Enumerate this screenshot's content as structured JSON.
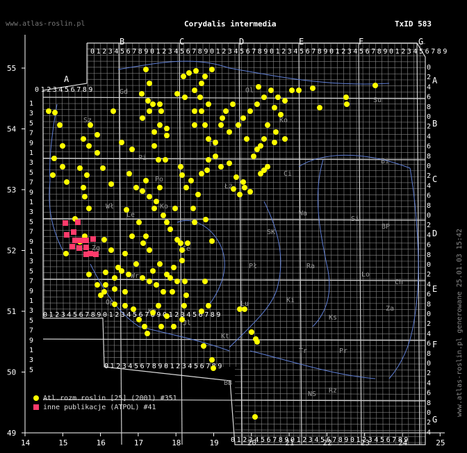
{
  "header": {
    "site": "www.atlas-roslin.pl",
    "title": "Corydalis intermedia",
    "taxid": "TxID 583"
  },
  "side_note": "www.atlas-roslin.pl generowane 25.01.03 15:42",
  "axes": {
    "x_ticks": [
      "14",
      "15",
      "16",
      "17",
      "18",
      "19",
      "20",
      "21",
      "22",
      "23",
      "24",
      "25"
    ],
    "y_ticks": [
      "49",
      "50",
      "51",
      "52",
      "53",
      "54",
      "55"
    ]
  },
  "grid_labels": {
    "columns": [
      "A",
      "B",
      "C",
      "D",
      "E",
      "F",
      "G"
    ],
    "rows": [
      "A",
      "B",
      "C",
      "D",
      "E",
      "F",
      "G"
    ],
    "digits": "0123456789"
  },
  "region_codes": [
    "Gd",
    "Su",
    "Ko",
    "Ol",
    "Bi",
    "Sz",
    "Pi",
    "To",
    "Ci",
    "Wa",
    "Si",
    "Łż",
    "Lo",
    "BP",
    "Po",
    "Ko",
    "SK",
    "Pł",
    "Ra",
    "Lu",
    "Ch",
    "Wr",
    "Op",
    "Kt",
    "Ki",
    "Tr",
    "Za",
    "Rz",
    "Ks",
    "NS",
    "BB",
    "Pr",
    "Ka",
    "Jl",
    "Zg",
    "Wł",
    "Le",
    "Ce"
  ],
  "legend": [
    {
      "label": "Atl.rozm.roslin [25] (2001) #351",
      "symbol": "dot",
      "color": "#ffff00"
    },
    {
      "label": "inne publikacje (ATPOL) #41",
      "symbol": "square",
      "color": "#ff3b6b"
    }
  ],
  "colors": {
    "grid": "#8a8a8a",
    "border": "#5f7fd6",
    "dots": "#ffff00",
    "squares": "#ff3b6b",
    "background": "#000000"
  }
}
